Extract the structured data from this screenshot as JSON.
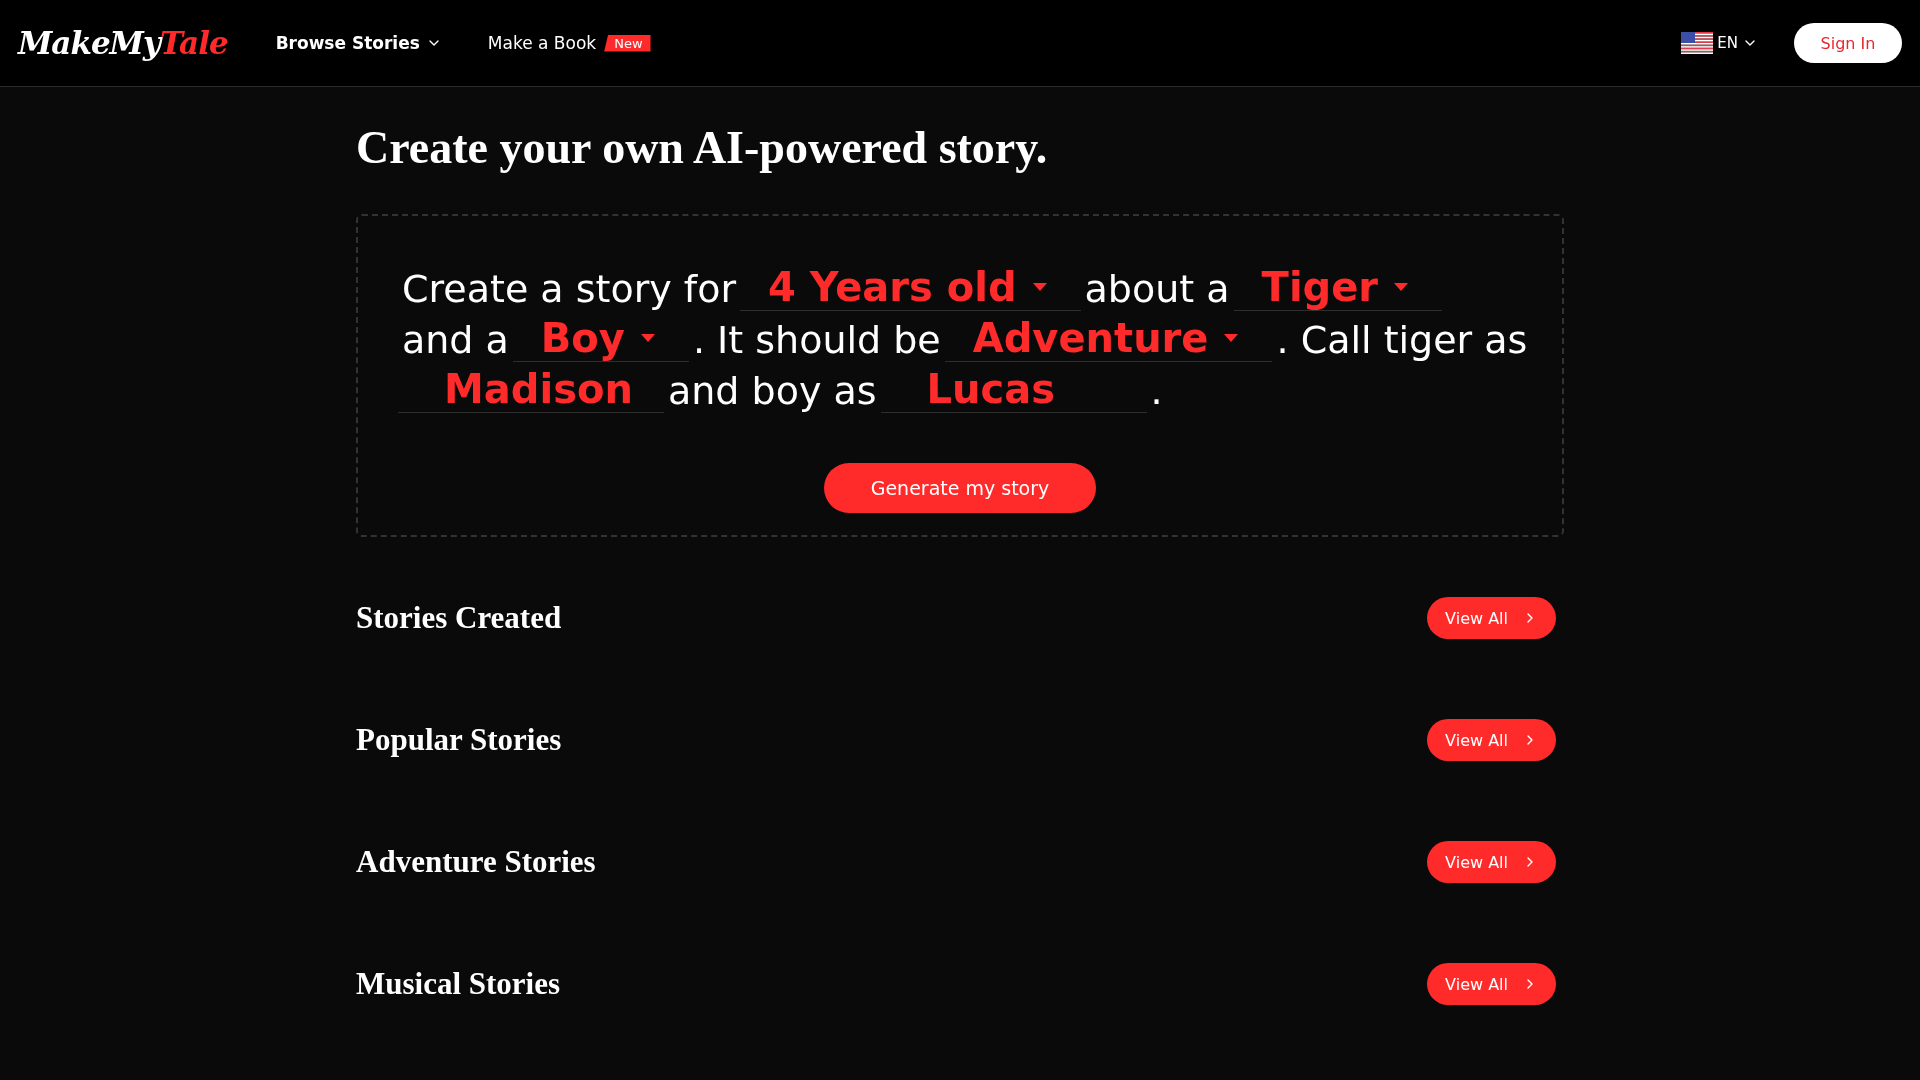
{
  "header": {
    "logo": [
      {
        "text": "MakeMy",
        "accent": false
      },
      {
        "text": "Tale",
        "accent": true
      }
    ],
    "nav": [
      {
        "label": "Browse Stories",
        "kind": "dropdown"
      },
      {
        "label": "Make a Book",
        "kind": "link",
        "badge": "New"
      }
    ],
    "language": "EN",
    "sign_in": "Sign In"
  },
  "title": "Create your own AI-powered story.",
  "builder": {
    "lines": [
      [
        {
          "kind": "text",
          "text": "Create a story for"
        },
        {
          "kind": "select",
          "value": "4 Years old"
        },
        {
          "kind": "text",
          "text": "about a"
        },
        {
          "kind": "select",
          "value": "Tiger"
        }
      ],
      [
        {
          "kind": "text",
          "text": "and a"
        },
        {
          "kind": "select",
          "value": "Boy"
        },
        {
          "kind": "text",
          "text": ". It should be"
        },
        {
          "kind": "select",
          "value": "Adventure"
        },
        {
          "kind": "text",
          "text": ". Call tiger as"
        }
      ],
      [
        {
          "kind": "input",
          "value": "Madison"
        },
        {
          "kind": "text",
          "text": "and boy as"
        },
        {
          "kind": "input",
          "value": "Lucas"
        },
        {
          "kind": "text",
          "text": "."
        }
      ]
    ],
    "button": "Generate my story"
  },
  "sections": [
    {
      "title": "Stories Created",
      "button": "View All"
    },
    {
      "title": "Popular Stories",
      "button": "View All"
    },
    {
      "title": "Adventure Stories",
      "button": "View All"
    },
    {
      "title": "Musical Stories",
      "button": "View All"
    }
  ]
}
